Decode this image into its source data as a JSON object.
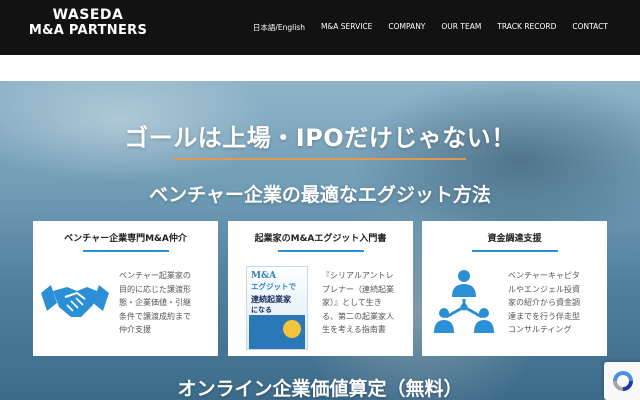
{
  "header": {
    "logo_line1": "WASEDA",
    "logo_line2": "M&A PARTNERS",
    "nav": [
      "日本語/English",
      "M&A SERVICE",
      "COMPANY",
      "OUR TEAM",
      "TRACK RECORD",
      "CONTACT"
    ]
  },
  "hero": {
    "title": "ゴールは上場・IPOだけじゃない！",
    "subtitle": "ベンチャー企業の最適なエグジット方法"
  },
  "cards": [
    {
      "title": "ベンチャー企業専門M&A仲介",
      "lines": [
        "ベンチャー起業家の",
        "目的に応じた譲渡形",
        "態・企業価値・引継",
        "条件で譲渡成約まで",
        "仲介支援"
      ],
      "icon": "handshake-icon"
    },
    {
      "title": "起業家のM&Aエグジット入門書",
      "lines": [
        "『シリアルアントレ",
        "プレナー（連続起業",
        "家）』として生き",
        "る、第二の起業家人",
        "生を考える指南書"
      ],
      "icon": "book-cover",
      "book": {
        "line1": "M&A",
        "line2": "エグジットで",
        "line3": "連続起業家",
        "line4": "になる"
      }
    },
    {
      "title": "資金調達支援",
      "lines": [
        "ベンチャーキャピタ",
        "ルやエンジェル投資",
        "家の紹介から資金調",
        "達までを行う伴走型",
        "コンサルティング"
      ],
      "icon": "network-people-icon"
    }
  ],
  "bottom": {
    "title": "オンライン企業価値算定（無料）"
  },
  "colors": {
    "accent_blue": "#2b8fd6",
    "accent_orange": "#e2984f",
    "header_bg": "#121212"
  }
}
